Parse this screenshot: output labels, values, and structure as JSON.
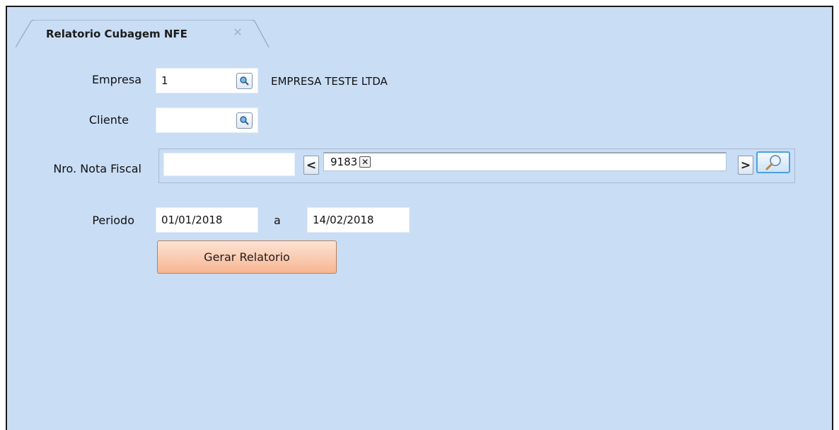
{
  "tab": {
    "title": "Relatorio Cubagem NFE",
    "close_icon": "close-icon"
  },
  "form": {
    "empresa": {
      "label": "Empresa",
      "value": "1",
      "name": "EMPRESA TESTE LTDA"
    },
    "cliente": {
      "label": "Cliente",
      "value": ""
    },
    "nota_fiscal": {
      "label": "Nro. Nota Fiscal",
      "input_value": "",
      "tokens": [
        "9183"
      ],
      "prev_label": "<",
      "next_label": ">"
    },
    "periodo": {
      "label": "Periodo",
      "start": "01/01/2018",
      "separator": "a",
      "end": "14/02/2018"
    },
    "generate_label": "Gerar Relatorio"
  },
  "colors": {
    "background": "#c9ddf5",
    "button": "#f7b592",
    "search_border": "#4aa2e0"
  }
}
